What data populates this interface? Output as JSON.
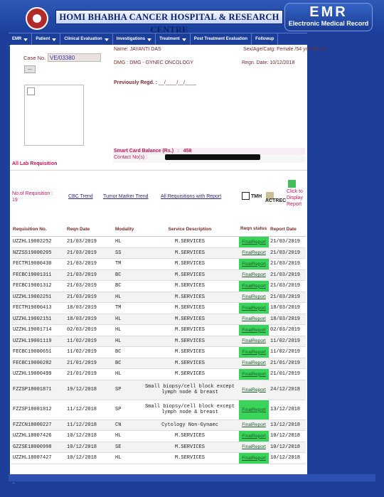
{
  "header": {
    "hospital_name": "HOMI BHABHA CANCER HOSPITAL & RESEARCH CENTRE",
    "emr_title": "EMR",
    "emr_subtitle": "Electronic Medical Record"
  },
  "menu": [
    {
      "label": "EMR",
      "dropdown": true
    },
    {
      "label": "Patient",
      "dropdown": true
    },
    {
      "label": "Clinical Evaluation",
      "dropdown": true
    },
    {
      "label": "Investigations",
      "dropdown": true
    },
    {
      "label": "Treatment",
      "dropdown": true
    },
    {
      "label": "Post Treatment Evaluation",
      "dropdown": false
    },
    {
      "label": "Followup",
      "dropdown": false
    }
  ],
  "patient": {
    "case_no_label": "Case No.",
    "case_no": "VE/03380",
    "lookup_button": "...",
    "name_label": "Name:",
    "name": "JAYANTI DAS",
    "sex_age_label": "Sex/Age/Catg:",
    "sex_age": "Female /54 yrs/ Gen-C",
    "dmg_label": "DMG :",
    "dmg": "DMG - GYNEC ONCOLOGY",
    "regn_date_label": "Regn. Date:",
    "regn_date": "10/12/2018",
    "prev_regd_label": "Previously Regd. :",
    "prev_regd": "__/____/__/____",
    "smart_card_label": "Smart Card Balance (Rs.)",
    "smart_card_sep": ":",
    "smart_card_value": "458",
    "contact_label": "Contact No(s) :"
  },
  "section": {
    "title": "All Lab Requisition",
    "no_of_req_label": "No.of Requisition :",
    "no_of_req": "19",
    "links": [
      "CBC Trend",
      "Tumor Marker Trend",
      "All Requisitions with Report"
    ],
    "tmh_label": "TMH",
    "actrec_label": "ACTREC",
    "click_label": "Click to Display Report",
    "colors": {
      "tmh": "#ffffff",
      "actrec": "#cbbf99",
      "green": "#3fbf5a"
    }
  },
  "table": {
    "headers": [
      "Requisition No.",
      "Reqn Date",
      "Modality",
      "Service Description",
      "Reqn status",
      "Report Date"
    ],
    "rows": [
      {
        "req": "UZZHL19002252",
        "date": "21/03/2019",
        "mod": "HL",
        "svc": "M.SERVICES",
        "status": "FinalReport",
        "rep": "21/03/2019"
      },
      {
        "req": "NZZSS19000205",
        "date": "21/03/2019",
        "mod": "SS",
        "svc": "M.SERVICES",
        "status": "FinalReport",
        "rep": "21/03/2019"
      },
      {
        "req": "FECTM19000430",
        "date": "21/03/2019",
        "mod": "TM",
        "svc": "M.SERVICES",
        "status": "FinalReport",
        "rep": "21/03/2019"
      },
      {
        "req": "FECBC19001311",
        "date": "21/03/2019",
        "mod": "BC",
        "svc": "M.SERVICES",
        "status": "FinalReport",
        "rep": "21/03/2019"
      },
      {
        "req": "FECBC19001312",
        "date": "21/03/2019",
        "mod": "BC",
        "svc": "M.SERVICES",
        "status": "FinalReport",
        "rep": "21/03/2019"
      },
      {
        "req": "UZZHL19002251",
        "date": "21/03/2019",
        "mod": "HL",
        "svc": "M.SERVICES",
        "status": "FinalReport",
        "rep": "21/03/2019"
      },
      {
        "req": "FECTM19000413",
        "date": "18/03/2019",
        "mod": "TM",
        "svc": "M.SERVICES",
        "status": "FinalReport",
        "rep": "18/03/2019"
      },
      {
        "req": "UZZHL19002151",
        "date": "18/03/2019",
        "mod": "HL",
        "svc": "M.SERVICES",
        "status": "FinalReport",
        "rep": "18/03/2019"
      },
      {
        "req": "UZZHL19001714",
        "date": "02/03/2019",
        "mod": "HL",
        "svc": "M.SERVICES",
        "status": "FinalReport",
        "rep": "02/03/2019"
      },
      {
        "req": "UZZHL19001119",
        "date": "11/02/2019",
        "mod": "HL",
        "svc": "M.SERVICES",
        "status": "FinalReport",
        "rep": "11/02/2019"
      },
      {
        "req": "FECBC19000651",
        "date": "11/02/2019",
        "mod": "BC",
        "svc": "M.SERVICES",
        "status": "FinalReport",
        "rep": "11/02/2019"
      },
      {
        "req": "FECBC19000282",
        "date": "21/01/2019",
        "mod": "BC",
        "svc": "M.SERVICES",
        "status": "FinalReport",
        "rep": "21/01/2019"
      },
      {
        "req": "UZZHL19000499",
        "date": "21/01/2019",
        "mod": "HL",
        "svc": "M.SERVICES",
        "status": "FinalReport",
        "rep": "21/01/2019"
      },
      {
        "req": "FZZSP18001871",
        "date": "19/12/2018",
        "mod": "SP",
        "svc": "Small biopsy/cell block except lymph node & breast",
        "status": "FinalReport",
        "rep": "24/12/2018"
      },
      {
        "req": "FZZSP18001812",
        "date": "11/12/2018",
        "mod": "SP",
        "svc": "Small biopsy/cell block except lymph node & breast",
        "status": "FinalReport",
        "rep": "13/12/2018"
      },
      {
        "req": "FZZCN18000227",
        "date": "11/12/2018",
        "mod": "CN",
        "svc": "Cytology Non-Gynaec",
        "status": "FinalReport",
        "rep": "13/12/2018"
      },
      {
        "req": "UZZHL18007426",
        "date": "10/12/2018",
        "mod": "HL",
        "svc": "M.SERVICES",
        "status": "FinalReport",
        "rep": "10/12/2018"
      },
      {
        "req": "GZZSE18000998",
        "date": "10/12/2018",
        "mod": "SE",
        "svc": "M.SERVICES",
        "status": "FinalReport",
        "rep": "10/12/2018"
      },
      {
        "req": "UZZHL18007427",
        "date": "10/12/2018",
        "mod": "HL",
        "svc": "M.SERVICES",
        "status": "FinalReport",
        "rep": "10/12/2018"
      }
    ]
  }
}
